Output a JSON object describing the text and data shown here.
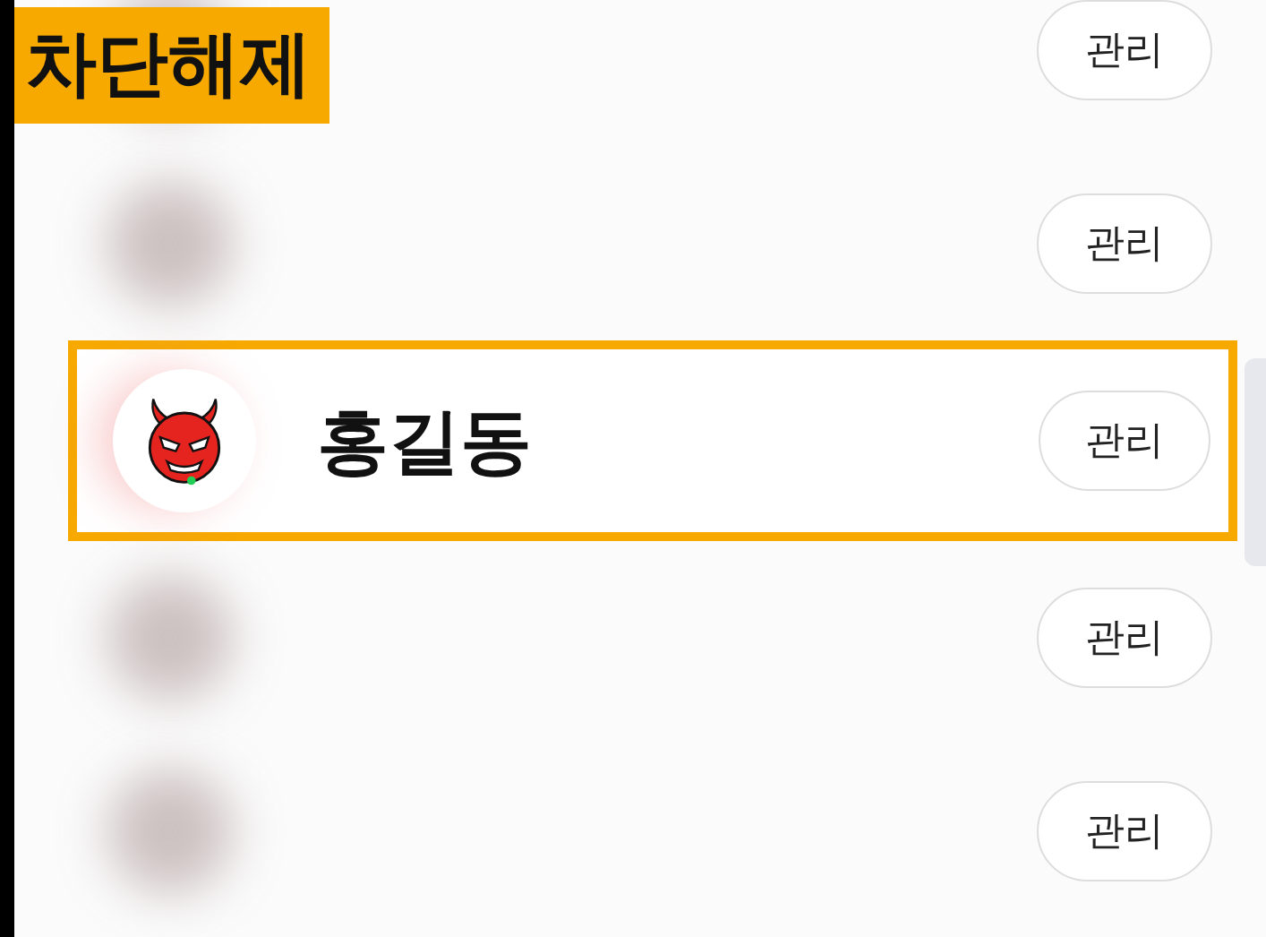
{
  "caption": "차단해제",
  "rows": [
    {
      "kind": "blurred",
      "button": "관리"
    },
    {
      "kind": "blurred",
      "button": "관리"
    },
    {
      "kind": "highlighted",
      "name": "홍길동",
      "button": "관리"
    },
    {
      "kind": "blurred",
      "button": "관리"
    },
    {
      "kind": "blurred",
      "button": "관리"
    }
  ]
}
